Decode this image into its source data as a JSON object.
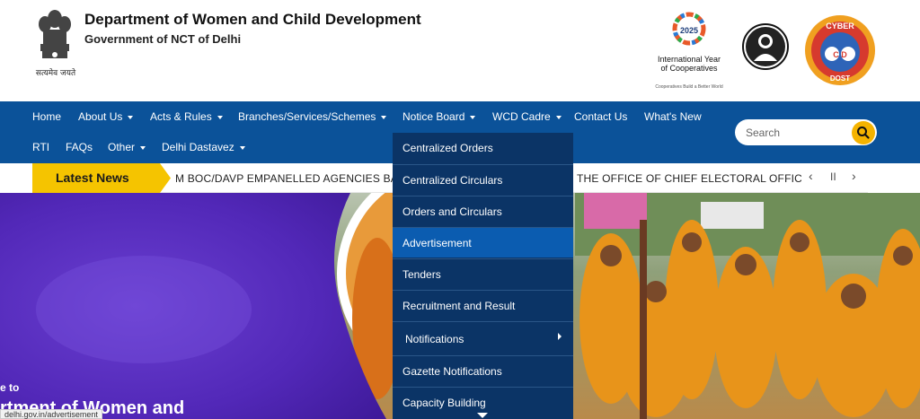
{
  "header": {
    "title": "Department of Women and Child Development",
    "subtitle": "Government of NCT of Delhi",
    "emblem_caption": "सत्यमेव जयते",
    "iyc_year": "2025",
    "iyc_title_line1": "International Year",
    "iyc_title_line2": "of Cooperatives",
    "iyc_tagline": "Cooperatives Build a Better World",
    "cyber_top": "CYBER",
    "cyber_mid": "C  D",
    "cyber_bottom": "DOST"
  },
  "nav": {
    "items": [
      {
        "label": "Home"
      },
      {
        "label": "About Us"
      },
      {
        "label": "Acts & Rules"
      },
      {
        "label": "Branches/Services/Schemes"
      },
      {
        "label": "Notice Board"
      },
      {
        "label": "WCD Cadre"
      },
      {
        "label": "Contact Us"
      },
      {
        "label": "What's New"
      },
      {
        "label": "RTI"
      },
      {
        "label": "FAQs"
      },
      {
        "label": "Other"
      },
      {
        "label": "Delhi Dastavez"
      }
    ],
    "search_placeholder": "Search"
  },
  "news": {
    "label": "Latest News",
    "ticker_left": "M BOC/DAVP EMPANELLED AGENCIES BASED",
    "ticker_right": "THE OFFICE OF CHIEF ELECTORAL OFFICER (CE",
    "prev": "‹",
    "pause": "II",
    "next": "›"
  },
  "dropdown": {
    "items": [
      {
        "label": "Centralized Orders"
      },
      {
        "label": "Centralized Circulars"
      },
      {
        "label": "Orders and Circulars"
      },
      {
        "label": "Advertisement"
      },
      {
        "label": "Tenders"
      },
      {
        "label": "Recruitment and Result"
      },
      {
        "label": "Notifications"
      },
      {
        "label": "Gazette Notifications"
      },
      {
        "label": "Capacity Building"
      }
    ],
    "active_index": 3
  },
  "banner": {
    "welcome": "e to",
    "title": "rtment of Women and"
  },
  "status_bar": {
    "url": "delhi.gov.in/advertisement"
  },
  "colors": {
    "nav_bg": "#0b5299",
    "dropdown_bg": "#0b3466",
    "dropdown_active": "#0b5cb0",
    "news_label": "#f5c400",
    "search_button": "#f5b300"
  }
}
